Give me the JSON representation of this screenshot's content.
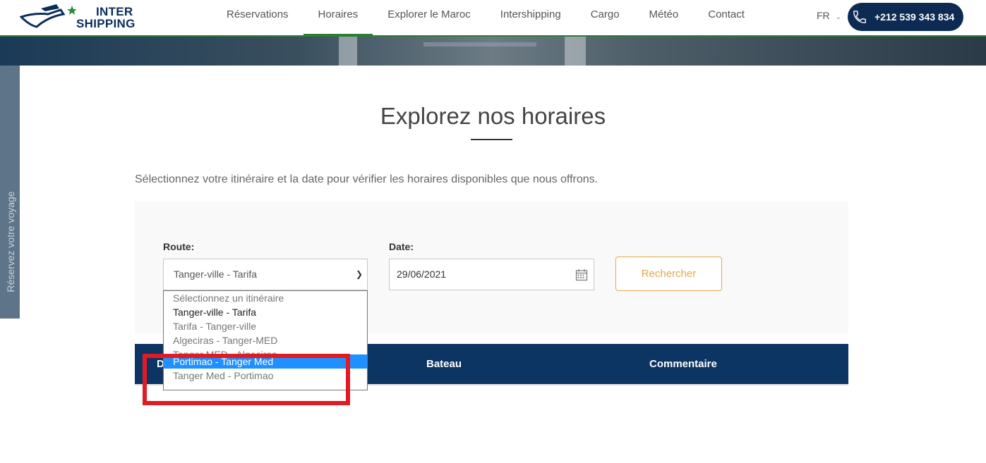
{
  "header": {
    "logo_line1": "INTER",
    "logo_line2": "SHIPPING",
    "nav": [
      {
        "label": "Réservations"
      },
      {
        "label": "Horaires"
      },
      {
        "label": "Explorer le Maroc"
      },
      {
        "label": "Intershipping"
      },
      {
        "label": "Cargo"
      },
      {
        "label": "Météo"
      },
      {
        "label": "Contact"
      }
    ],
    "active_nav": "Horaires",
    "language": "FR",
    "phone": "+212 539 343 834"
  },
  "side_tab": {
    "label": "Réservez votre voyage"
  },
  "main": {
    "title": "Explorez nos horaires",
    "subtitle": "Sélectionnez votre itinéraire et la date pour vérifier les horaires disponibles que nous offrons."
  },
  "form": {
    "route_label": "Route:",
    "route_value": "Tanger-ville - Tarifa",
    "date_label": "Date:",
    "date_value": "29/06/2021",
    "search_label": "Rechercher",
    "route_options": [
      "Sélectionnez un itinéraire",
      "Tanger-ville - Tarifa",
      "Tarifa - Tanger-ville",
      "Algeciras - Tanger-MED",
      "Tanger MED - Algeciras",
      "Portimao - Tanger Med",
      "Tanger Med - Portimao"
    ]
  },
  "table": {
    "headers": [
      "D",
      "Bateau",
      "Commentaire"
    ]
  },
  "colors": {
    "nav_active": "#2e7d32",
    "phone_bg": "#0d2b52",
    "table_header": "#0d3563",
    "search_button": "#e0a94a",
    "highlight": "#1e90ff",
    "annotation": "#e01b24"
  }
}
